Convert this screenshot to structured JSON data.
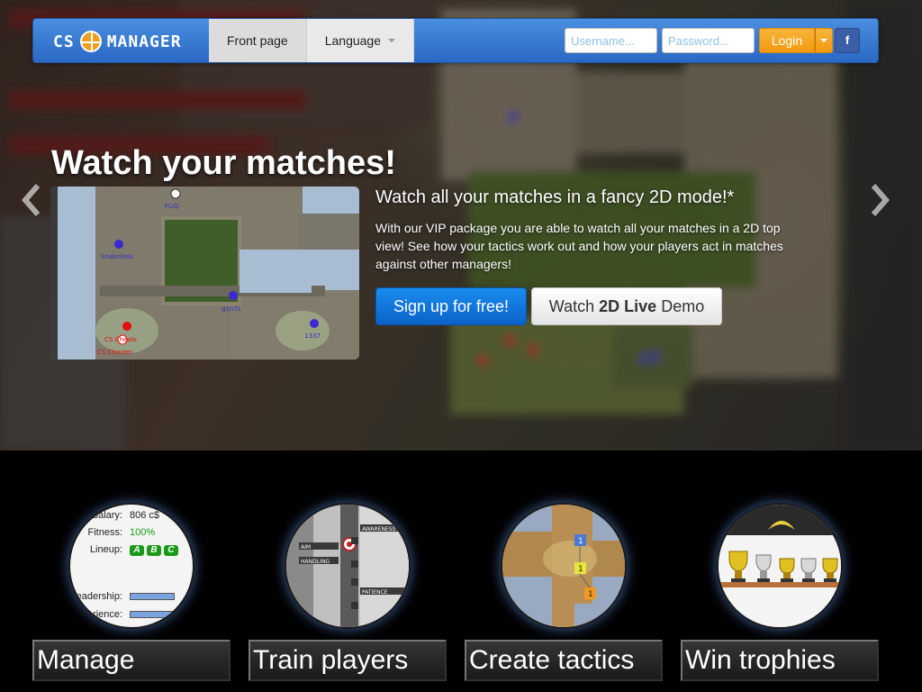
{
  "navbar": {
    "brand_left": "CS",
    "brand_right": "MANAGER",
    "tabs": [
      {
        "label": "Front page"
      },
      {
        "label": "Language"
      }
    ],
    "username_placeholder": "Username...",
    "password_placeholder": "Password...",
    "login_label": "Login",
    "facebook_label": "f"
  },
  "hero": {
    "title": "Watch your matches!",
    "subheading": "Watch all your matches in a fancy 2D mode!*",
    "description": "With our VIP package you are able to watch all your matches in a 2D top view! See how your tactics work out and how your players act in matches against other managers!",
    "signup_label": "Sign up for free!",
    "demo_label_pre": "Watch ",
    "demo_label_bold": "2D Live",
    "demo_label_post": " Demo",
    "thumb_players": [
      "FLIQ",
      "Snabnlesk",
      "g1n7s",
      "1337",
      "CS Cheats",
      "CS Cheater"
    ]
  },
  "features": [
    {
      "label": "Manage"
    },
    {
      "label": "Train players"
    },
    {
      "label": "Create tactics"
    },
    {
      "label": "Win trophies"
    }
  ],
  "manage_preview": {
    "salary_label": "Salary:",
    "salary_value": "806 c$",
    "fitness_label": "Fitness:",
    "fitness_value": "100%",
    "lineup_label": "Lineup:",
    "lineup_badges": [
      "A",
      "B",
      "C"
    ],
    "leadership_label": "Leadership:",
    "experience_label": "Experience:"
  },
  "train_preview": {
    "skills": [
      "AWARENESS",
      "AIM",
      "HANDLING",
      "PATIENCE"
    ]
  },
  "tactics_preview": {
    "markers": [
      "1",
      "1",
      "1"
    ]
  },
  "colors": {
    "nav_blue": "#2a68c4",
    "login_orange": "#f29a10",
    "facebook_blue": "#3b5ea8",
    "signup_blue": "#0b62c8",
    "fitness_green": "#1a9a1a"
  },
  "icons": [
    "logo-crosshair-icon",
    "caret-down-icon",
    "facebook-icon",
    "chevron-left-icon",
    "chevron-right-icon"
  ]
}
